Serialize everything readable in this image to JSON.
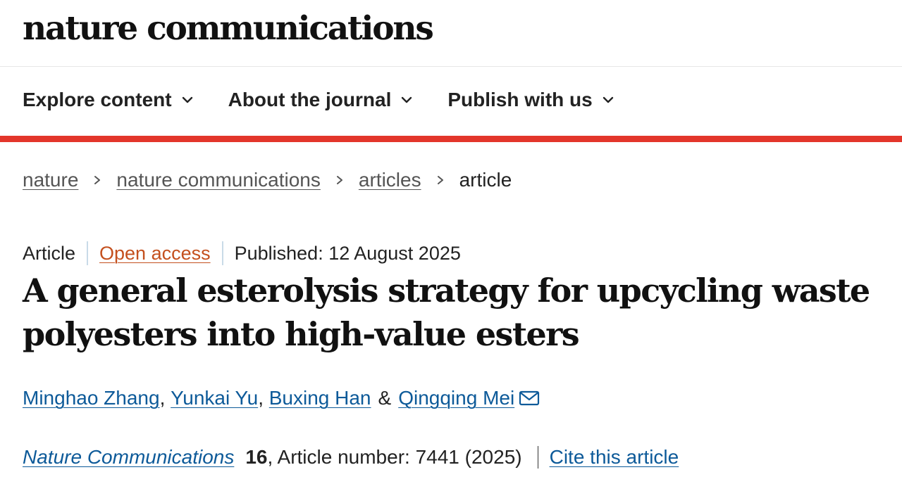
{
  "brand": {
    "name": "nature communications"
  },
  "nav": {
    "items": [
      {
        "label": "Explore content",
        "icon": "chevron-down-icon"
      },
      {
        "label": "About the journal",
        "icon": "chevron-down-icon"
      },
      {
        "label": "Publish with us",
        "icon": "chevron-down-icon"
      }
    ]
  },
  "colors": {
    "accent_rule": "#e3362b",
    "link": "#0d5a99",
    "open_access": "#c4501e",
    "divider": "#c9dbe8"
  },
  "breadcrumb": {
    "items": [
      "nature",
      "nature communications",
      "articles"
    ],
    "current": "article",
    "separator_icon": "chevron-right-icon"
  },
  "article": {
    "type": "Article",
    "access": "Open access",
    "published": "Published: 12 August 2025",
    "title": "A general esterolysis strategy for upcycling waste polyesters into high-value esters",
    "authors": [
      "Minghao Zhang",
      "Yunkai Yu",
      "Buxing Han",
      "Qingqing Mei"
    ],
    "author_separator": ",",
    "author_conjunction": "&",
    "contact_icon": "mail-icon",
    "journal": "Nature Communications",
    "volume": "16",
    "article_number": ", Article number: 7441 (2025)",
    "cite_label": "Cite this article"
  }
}
